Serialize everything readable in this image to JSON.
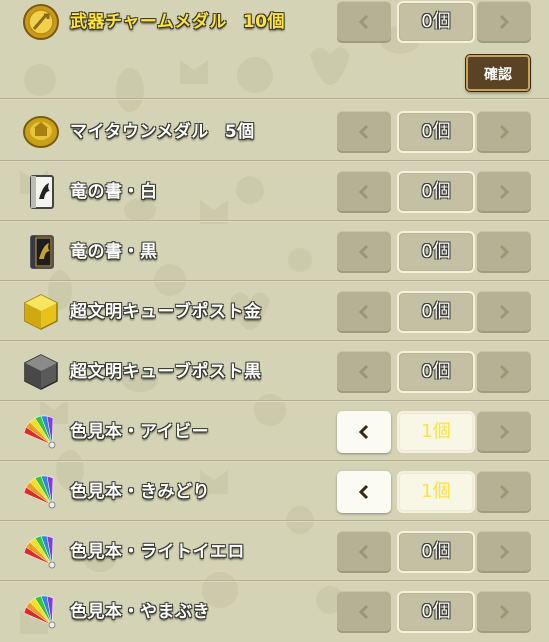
{
  "colors": {
    "background": "#d4d3b5",
    "label_text": "#ffffff",
    "highlight_text": "#ffe23a",
    "stepper_disabled": "#b5b194",
    "stepper_active": "#fbfbf3",
    "confirm_button": "#5a4224"
  },
  "header": {
    "item": {
      "name": "武器チャームメダル",
      "qty": "10個",
      "icon": "charm-medal-icon",
      "count": "0個",
      "selected": false,
      "minus_enabled": false,
      "plus_enabled": false
    },
    "confirm_label": "確認"
  },
  "items": [
    {
      "name": "マイタウンメダル",
      "qty": "5個",
      "icon": "mytown-medal-icon",
      "count": "0個",
      "selected": false,
      "minus_enabled": false
    },
    {
      "name": "竜の書・白",
      "qty": "",
      "icon": "white-dragon-book-icon",
      "count": "0個",
      "selected": false,
      "minus_enabled": false
    },
    {
      "name": "竜の書・黒",
      "qty": "",
      "icon": "black-dragon-book-icon",
      "count": "0個",
      "selected": false,
      "minus_enabled": false
    },
    {
      "name": "超文明キューブポスト金",
      "qty": "",
      "icon": "gold-cube-post-icon",
      "count": "0個",
      "selected": false,
      "minus_enabled": false
    },
    {
      "name": "超文明キューブポスト黒",
      "qty": "",
      "icon": "black-cube-post-icon",
      "count": "0個",
      "selected": false,
      "minus_enabled": false
    },
    {
      "name": "色見本・アイビー",
      "qty": "",
      "icon": "color-swatch-fan-icon",
      "count": "1個",
      "selected": true,
      "minus_enabled": true
    },
    {
      "name": "色見本・きみどり",
      "qty": "",
      "icon": "color-swatch-fan-icon",
      "count": "1個",
      "selected": true,
      "minus_enabled": true
    },
    {
      "name": "色見本・ライトイエロ",
      "qty": "",
      "icon": "color-swatch-fan-icon",
      "count": "0個",
      "selected": false,
      "minus_enabled": false
    },
    {
      "name": "色見本・やまぶき",
      "qty": "",
      "icon": "color-swatch-fan-icon",
      "count": "0個",
      "selected": false,
      "minus_enabled": false
    }
  ]
}
